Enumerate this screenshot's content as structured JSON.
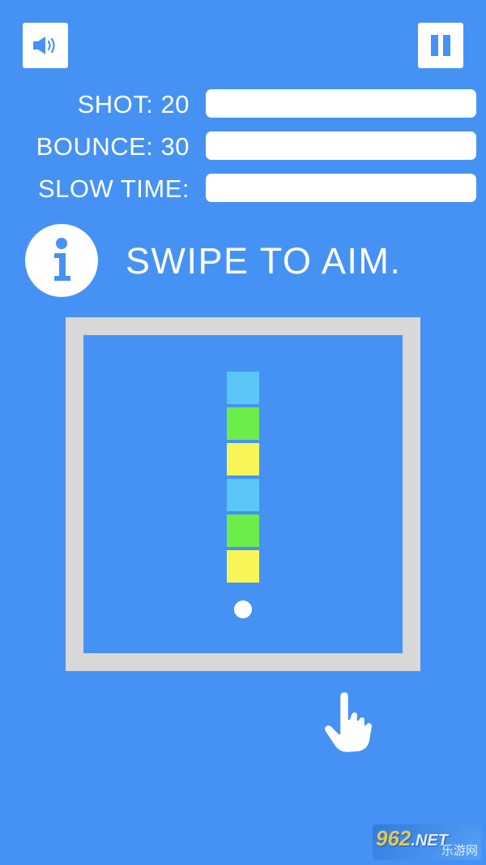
{
  "hud": {
    "sound_icon": "speaker-volume-icon",
    "pause_icon": "pause-icon",
    "stats": [
      {
        "label": "SHOT: 20"
      },
      {
        "label": "BOUNCE: 30"
      },
      {
        "label": "SLOW TIME:"
      }
    ]
  },
  "hint": {
    "icon": "info-icon",
    "text": "SWIPE TO AIM."
  },
  "board": {
    "blocks": [
      {
        "color": "#5bc6f7"
      },
      {
        "color": "#6ced4a"
      },
      {
        "color": "#f8f656"
      },
      {
        "color": "#5bc6f7"
      },
      {
        "color": "#6ced4a"
      },
      {
        "color": "#f8f656"
      }
    ]
  },
  "colors": {
    "background": "#4592f4",
    "frame": "#d8d8d8",
    "white": "#ffffff"
  },
  "watermark": {
    "logo": "962",
    "logo_suffix": ".NET",
    "sub": "乐游网"
  }
}
